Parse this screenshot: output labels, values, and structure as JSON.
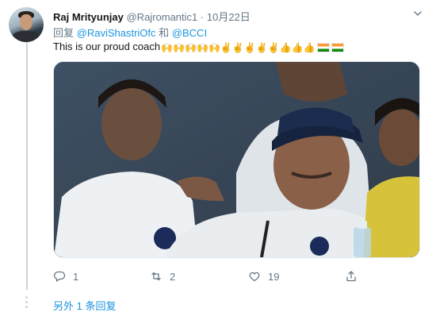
{
  "tweet": {
    "author_name": "Raj Mrityunjay",
    "author_handle": "@Rajromantic1",
    "separator": "·",
    "date": "10月22日",
    "reply_prefix": "回复",
    "reply_mention_1": "@RaviShastriOfc",
    "reply_conjunction": "和",
    "reply_mention_2": "@BCCI",
    "text": "This is our proud coach",
    "emojis": [
      "🙌",
      "🙌",
      "🙌",
      "🙌",
      "🙌",
      "✌",
      "✌",
      "✌",
      "✌",
      "✌",
      "👍",
      "👍",
      "👍"
    ],
    "flags": [
      "indian-flag",
      "indian-flag"
    ],
    "photo_icon": "photo-of-spectators"
  },
  "actions": {
    "reply_count": "1",
    "retweet_count": "2",
    "like_count": "19",
    "reply_icon": "reply-icon",
    "retweet_icon": "retweet-icon",
    "like_icon": "heart-icon",
    "share_icon": "share-icon"
  },
  "thread": {
    "more_replies": "另外 1 条回复"
  },
  "colors": {
    "link": "#1b95e0",
    "muted": "#657786",
    "text": "#14171a",
    "thread_line": "#ccd6dd"
  }
}
